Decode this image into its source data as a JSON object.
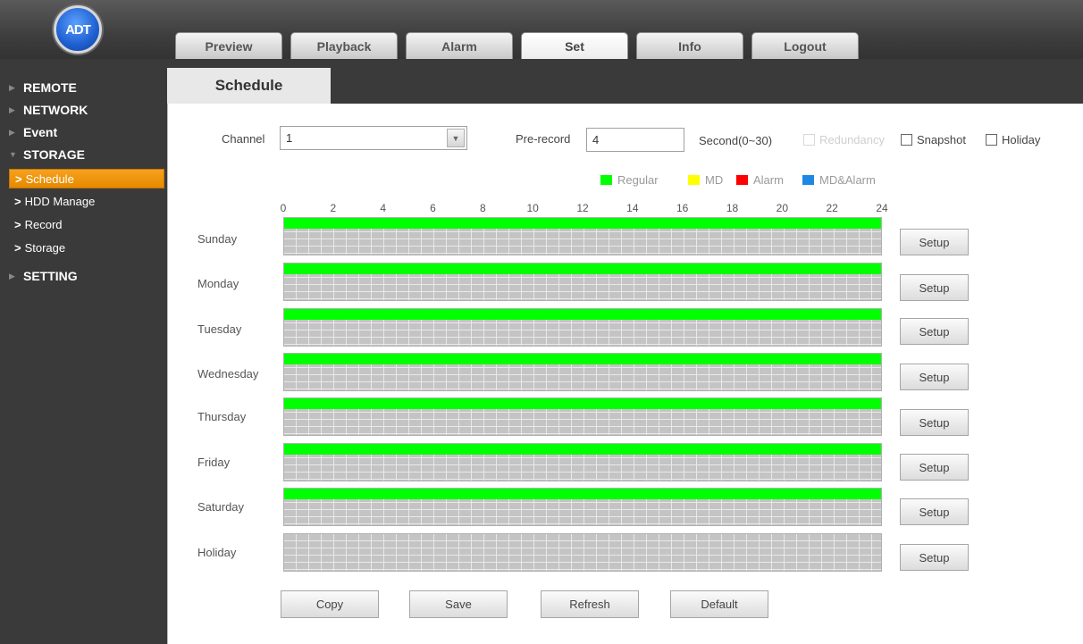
{
  "app": {
    "logo_text": "ADT",
    "logo_color": "#1e5fd0"
  },
  "nav": {
    "tabs": [
      {
        "label": "Preview"
      },
      {
        "label": "Playback"
      },
      {
        "label": "Alarm"
      },
      {
        "label": "Set",
        "active": true
      },
      {
        "label": "Info"
      },
      {
        "label": "Logout"
      }
    ]
  },
  "sidebar": {
    "sections": [
      {
        "label": "REMOTE",
        "state": "collapsed"
      },
      {
        "label": "NETWORK",
        "state": "collapsed"
      },
      {
        "label": "Event",
        "state": "collapsed"
      },
      {
        "label": "STORAGE",
        "state": "expanded",
        "items": [
          {
            "label": "Schedule",
            "active": true
          },
          {
            "label": "HDD Manage"
          },
          {
            "label": "Record"
          },
          {
            "label": "Storage"
          }
        ]
      },
      {
        "label": "SETTING",
        "state": "collapsed"
      }
    ],
    "accent_color": "#f39c12"
  },
  "page": {
    "title": "Schedule"
  },
  "form": {
    "channel_label": "Channel",
    "channel_value": "1",
    "prerecord_label": "Pre-record",
    "prerecord_value": "4",
    "prerecord_unit": "Second(0~30)",
    "redundancy_label": "Redundancy",
    "redundancy_disabled": true,
    "snapshot_label": "Snapshot",
    "snapshot_checked": false,
    "holiday_label": "Holiday",
    "holiday_checked": false
  },
  "legend": [
    {
      "label": "Regular",
      "color": "#00ff00"
    },
    {
      "label": "MD",
      "color": "#ffff00"
    },
    {
      "label": "Alarm",
      "color": "#ff0000"
    },
    {
      "label": "MD&Alarm",
      "color": "#1e88e5"
    }
  ],
  "schedule": {
    "hours": [
      "0",
      "2",
      "4",
      "6",
      "8",
      "10",
      "12",
      "14",
      "16",
      "18",
      "20",
      "22",
      "24"
    ],
    "setup_label": "Setup",
    "days": [
      {
        "label": "Sunday",
        "regular": [
          0,
          24
        ]
      },
      {
        "label": "Monday",
        "regular": [
          0,
          24
        ]
      },
      {
        "label": "Tuesday",
        "regular": [
          0,
          24
        ]
      },
      {
        "label": "Wednesday",
        "regular": [
          0,
          24
        ]
      },
      {
        "label": "Thursday",
        "regular": [
          0,
          24
        ]
      },
      {
        "label": "Friday",
        "regular": [
          0,
          24
        ]
      },
      {
        "label": "Saturday",
        "regular": [
          0,
          24
        ]
      },
      {
        "label": "Holiday",
        "regular": null
      }
    ]
  },
  "buttons": {
    "copy": "Copy",
    "save": "Save",
    "refresh": "Refresh",
    "default": "Default"
  }
}
